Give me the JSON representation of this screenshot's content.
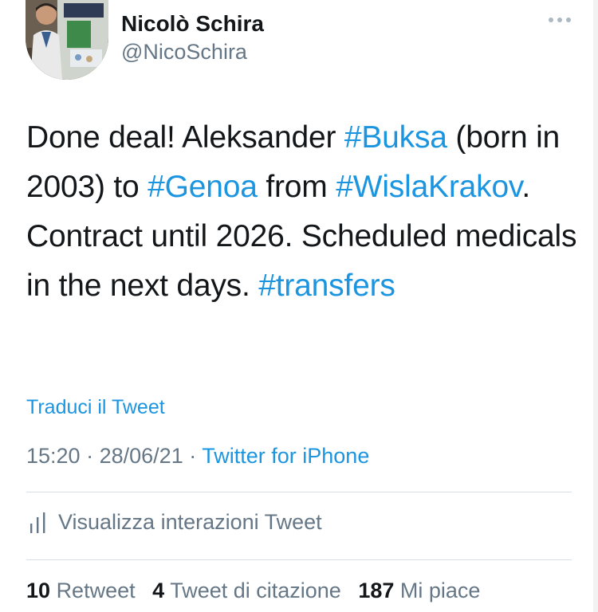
{
  "author": {
    "name": "Nicolò Schira",
    "handle": "@NicoSchira"
  },
  "tweet": {
    "segments": [
      {
        "text": "Done deal! Aleksander ",
        "hashtag": false
      },
      {
        "text": "#Buksa",
        "hashtag": true
      },
      {
        "text": " (born in 2003) to ",
        "hashtag": false
      },
      {
        "text": "#Genoa",
        "hashtag": true
      },
      {
        "text": " from ",
        "hashtag": false
      },
      {
        "text": "#WislaKrakov",
        "hashtag": true
      },
      {
        "text": ". Contract until 2026. Scheduled medicals in the next days. ",
        "hashtag": false
      },
      {
        "text": "#transfers",
        "hashtag": true
      }
    ],
    "translate_label": "Traduci il Tweet",
    "time": "15:20",
    "date": "28/06/21",
    "separator": "·",
    "source": "Twitter for iPhone"
  },
  "analytics": {
    "label": "Visualizza interazioni Tweet",
    "icon": "analytics-bar-icon"
  },
  "stats": {
    "retweets_count": "10",
    "retweets_label": "Retweet",
    "quotes_count": "4",
    "quotes_label": "Tweet di citazione",
    "likes_count": "187",
    "likes_label": "Mi piace"
  },
  "colors": {
    "link": "#1b95e0",
    "secondary_text": "#657786",
    "primary_text": "#14171a",
    "divider": "#d9dfe3"
  }
}
